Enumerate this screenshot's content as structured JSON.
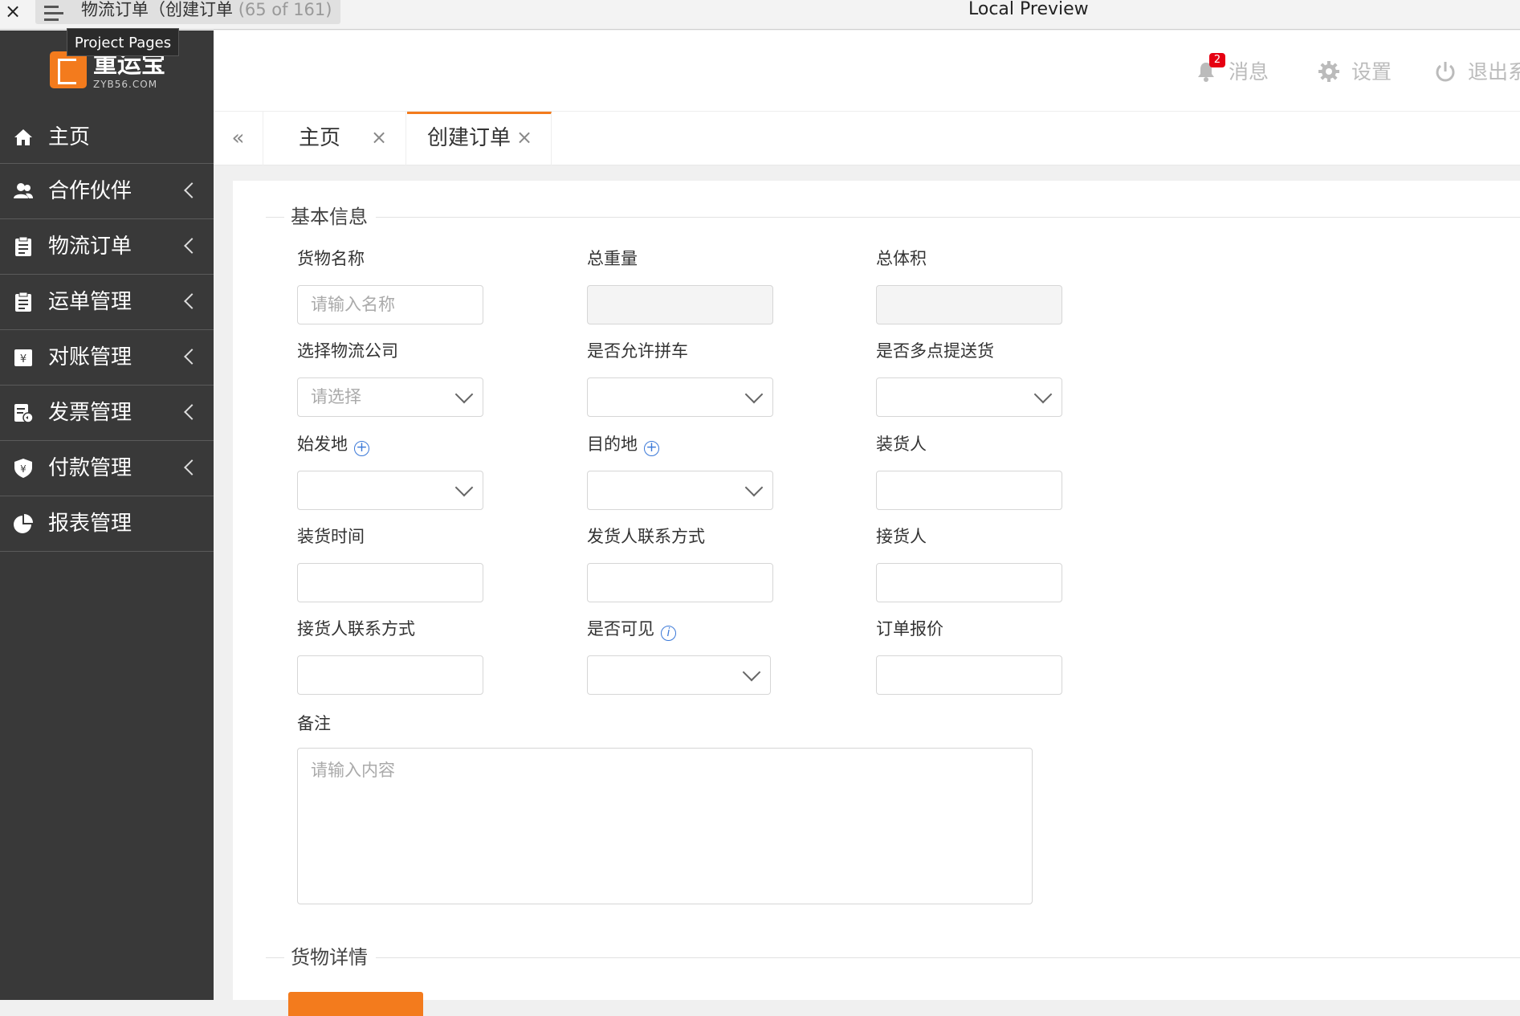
{
  "preview": {
    "close": "×",
    "title": "物流订单（创建订单",
    "count": "(65 of 161)",
    "center_title": "Local Preview",
    "tooltip": "Project Pages"
  },
  "logo": {
    "name": "重运宝",
    "domain": "ZYB56.COM"
  },
  "sidebar": {
    "items": [
      {
        "label": "主页",
        "icon": "home-icon",
        "has_children": false
      },
      {
        "label": "合作伙伴",
        "icon": "users-icon",
        "has_children": true
      },
      {
        "label": "物流订单",
        "icon": "clipboard-icon",
        "has_children": true
      },
      {
        "label": "运单管理",
        "icon": "clipboard-icon",
        "has_children": true
      },
      {
        "label": "对账管理",
        "icon": "yen-icon",
        "has_children": true
      },
      {
        "label": "发票管理",
        "icon": "invoice-icon",
        "has_children": true
      },
      {
        "label": "付款管理",
        "icon": "payment-shield-icon",
        "has_children": true
      },
      {
        "label": "报表管理",
        "icon": "pie-chart-icon",
        "has_children": false
      }
    ]
  },
  "header": {
    "messages_label": "消息",
    "messages_badge": "2",
    "settings_label": "设置",
    "logout_label": "退出系"
  },
  "tabs": {
    "collapse": "«",
    "items": [
      {
        "label": "主页",
        "close": "×",
        "active": false
      },
      {
        "label": "创建订单",
        "close": "×",
        "active": true
      }
    ]
  },
  "form": {
    "section_basic": "基本信息",
    "section_goods": "货物详情",
    "goods_name_label": "货物名称",
    "goods_name_placeholder": "请输入名称",
    "total_weight_label": "总重量",
    "total_volume_label": "总体积",
    "logistics_company_label": "选择物流公司",
    "logistics_company_placeholder": "请选择",
    "allow_carpool_label": "是否允许拼车",
    "multi_point_label": "是否多点提送货",
    "origin_label": "始发地",
    "destination_label": "目的地",
    "loader_label": "装货人",
    "loading_time_label": "装货时间",
    "shipper_contact_label": "发货人联系方式",
    "receiver_label": "接货人",
    "receiver_contact_label": "接货人联系方式",
    "visible_label": "是否可见",
    "order_quote_label": "订单报价",
    "remark_label": "备注",
    "remark_placeholder": "请输入内容"
  },
  "colors": {
    "accent": "#f37b1d",
    "sidebar": "#393939",
    "badge": "#e60012",
    "info": "#3a78d8"
  }
}
